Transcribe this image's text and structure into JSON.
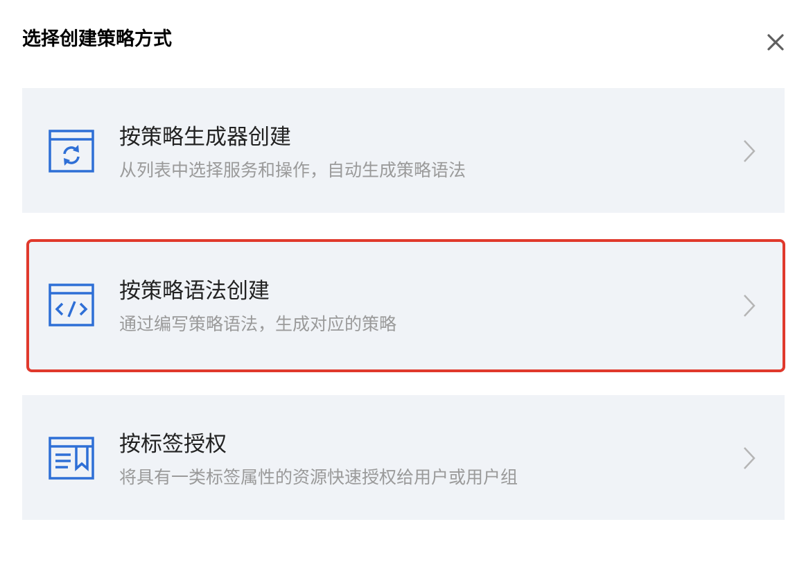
{
  "dialog": {
    "title": "选择创建策略方式",
    "close_icon": "close-icon"
  },
  "options": [
    {
      "icon": "refresh-window-icon",
      "title": "按策略生成器创建",
      "description": "从列表中选择服务和操作，自动生成策略语法",
      "selected": false
    },
    {
      "icon": "code-window-icon",
      "title": "按策略语法创建",
      "description": "通过编写策略语法，生成对应的策略",
      "selected": true
    },
    {
      "icon": "tag-document-icon",
      "title": "按标签授权",
      "description": "将具有一类标签属性的资源快速授权给用户或用户组",
      "selected": false
    }
  ],
  "colors": {
    "accent_blue": "#2e6fd6",
    "selection_red": "#e0392c",
    "card_background": "#f0f3f7",
    "title_text": "#222222",
    "description_text": "#9a9a9a"
  }
}
